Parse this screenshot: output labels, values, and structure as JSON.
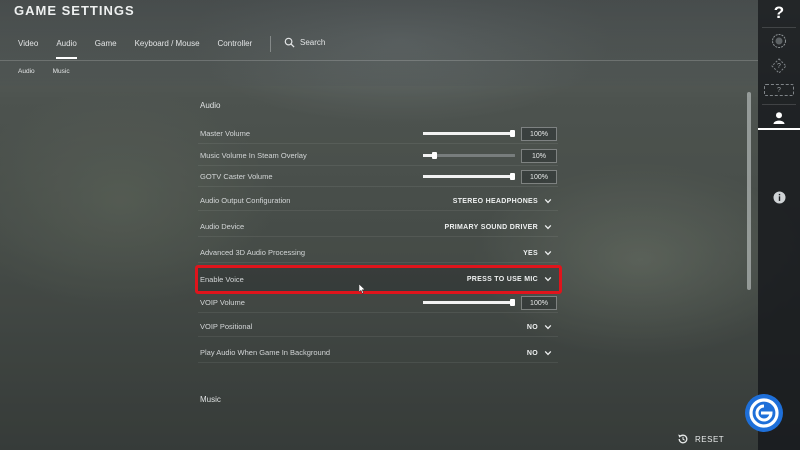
{
  "header": {
    "title": "GAME SETTINGS",
    "tabs": [
      {
        "label": "Video"
      },
      {
        "label": "Audio"
      },
      {
        "label": "Game"
      },
      {
        "label": "Keyboard / Mouse"
      },
      {
        "label": "Controller"
      }
    ],
    "active_tab": "Audio",
    "search_label": "Search",
    "sub_tabs": [
      {
        "label": "Audio"
      },
      {
        "label": "Music"
      }
    ],
    "active_sub_tab": "Audio"
  },
  "sections": {
    "audio_title": "Audio",
    "music_title": "Music"
  },
  "settings": {
    "master_volume": {
      "label": "Master Volume",
      "value": "100%",
      "level": 1.0
    },
    "music_volume_overlay": {
      "label": "Music Volume In Steam Overlay",
      "value": "10%",
      "level": 0.1
    },
    "gotv_caster_volume": {
      "label": "GOTV Caster Volume",
      "value": "100%",
      "level": 1.0
    },
    "audio_output_config": {
      "label": "Audio Output Configuration",
      "value": "STEREO HEADPHONES"
    },
    "audio_device": {
      "label": "Audio Device",
      "value": "PRIMARY SOUND DRIVER"
    },
    "advanced_3d": {
      "label": "Advanced 3D Audio Processing",
      "value": "YES"
    },
    "enable_voice": {
      "label": "Enable Voice",
      "value": "PRESS TO USE MIC"
    },
    "voip_volume": {
      "label": "VOIP Volume",
      "value": "100%",
      "level": 1.0
    },
    "voip_positional": {
      "label": "VOIP Positional",
      "value": "NO"
    },
    "play_audio_background": {
      "label": "Play Audio When Game In Background",
      "value": "NO"
    }
  },
  "footer": {
    "reset_label": "RESET"
  },
  "sidebar": {
    "help_icon_text": "?",
    "small_q1": "?",
    "small_q2": "?"
  },
  "colors": {
    "highlight": "#e0141c",
    "logo_blue": "#1e6fd9"
  },
  "icons": [
    "search-icon",
    "chevron-down-icon",
    "help-icon",
    "rank-badge-icon",
    "unknown-rank-icon",
    "profile-icon",
    "info-icon",
    "reset-icon",
    "site-logo-icon"
  ]
}
